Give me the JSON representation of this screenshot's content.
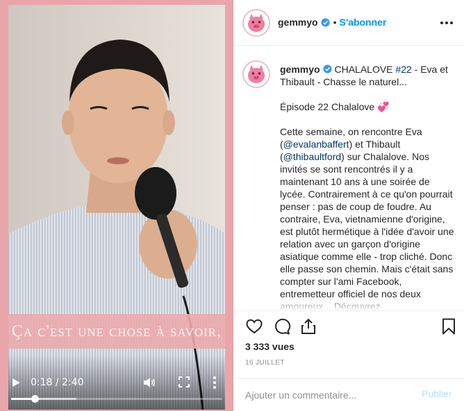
{
  "video": {
    "caption": "Ça c'est une chose à savoir,",
    "time_display": "0:18 / 2:40",
    "progress_fraction": 0.113,
    "buffered_fraction": 0.31,
    "icons": [
      "play-icon",
      "volume-icon",
      "fullscreen-icon",
      "more-vertical-icon"
    ]
  },
  "header": {
    "username": "gemmyo",
    "separator": "•",
    "follow_label": "S'abonner",
    "icons": [
      "avatar-pig",
      "verified-badge-icon",
      "more-horizontal-icon"
    ]
  },
  "caption": {
    "username": "gemmyo",
    "title_prefix": "CHALALOVE ",
    "hashtag": "#22",
    "title_rest": " - Eva et Thibault - Chasse le naturel...",
    "episode_line": "Épisode 22 Chalalove 💞",
    "body_intro": "Cette semaine, on rencontre Eva (",
    "mention_1": "@evalanbaffert",
    "body_mid": ") et Thibault (",
    "mention_2": "@thibaultford",
    "body_rest": ") sur Chalalove. Nos invités se sont rencontrés il y a maintenant 10 ans à une soirée de lycée. Contrairement à ce qu'on pourrait penser : pas de coup de foudre. Au contraire, Eva, vietnamienne d'origine, est plutôt hermétique à l'idée d'avoir une relation avec un garçon d'origine asiatique comme elle - trop cliché. Donc elle passe son chemin. Mais c'était sans compter sur l'ami Facebook, entremetteur officiel de nos deux amoureux... Découvrez"
  },
  "stats": {
    "views": "3 333 vues",
    "date": "16 JUILLET"
  },
  "comment": {
    "placeholder": "Ajouter un commentaire...",
    "publish_label": "Publier"
  },
  "colors": {
    "accent_blue": "#0095f6",
    "link_dark_blue": "#00376b",
    "brand_pink": "#e9a6aa",
    "publish_disabled": "#b2dffc"
  }
}
